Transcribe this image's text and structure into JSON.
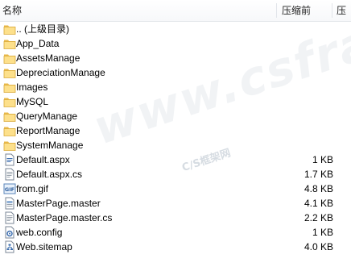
{
  "header": {
    "columns": {
      "name": "名称",
      "size": "压缩前",
      "compressed": "压"
    }
  },
  "files": [
    {
      "name": ".. (上级目录)",
      "size": "",
      "icon": "folder-icon"
    },
    {
      "name": "App_Data",
      "size": "",
      "icon": "folder-icon"
    },
    {
      "name": "AssetsManage",
      "size": "",
      "icon": "folder-icon"
    },
    {
      "name": "DepreciationManage",
      "size": "",
      "icon": "folder-icon"
    },
    {
      "name": "Images",
      "size": "",
      "icon": "folder-icon"
    },
    {
      "name": "MySQL",
      "size": "",
      "icon": "folder-icon"
    },
    {
      "name": "QueryManage",
      "size": "",
      "icon": "folder-icon"
    },
    {
      "name": "ReportManage",
      "size": "",
      "icon": "folder-icon"
    },
    {
      "name": "SystemManage",
      "size": "",
      "icon": "folder-icon"
    },
    {
      "name": "Default.aspx",
      "size": "1 KB",
      "icon": "aspx-file-icon"
    },
    {
      "name": "Default.aspx.cs",
      "size": "1.7 KB",
      "icon": "cs-file-icon"
    },
    {
      "name": "from.gif",
      "size": "4.8 KB",
      "icon": "gif-file-icon"
    },
    {
      "name": "MasterPage.master",
      "size": "4.1 KB",
      "icon": "master-file-icon"
    },
    {
      "name": "MasterPage.master.cs",
      "size": "2.2 KB",
      "icon": "cs-file-icon"
    },
    {
      "name": "web.config",
      "size": "1 KB",
      "icon": "config-file-icon"
    },
    {
      "name": "Web.sitemap",
      "size": "4.0 KB",
      "icon": "sitemap-file-icon"
    }
  ],
  "watermark": {
    "main": "www.csframework.com",
    "sub": "C/S框架网"
  }
}
